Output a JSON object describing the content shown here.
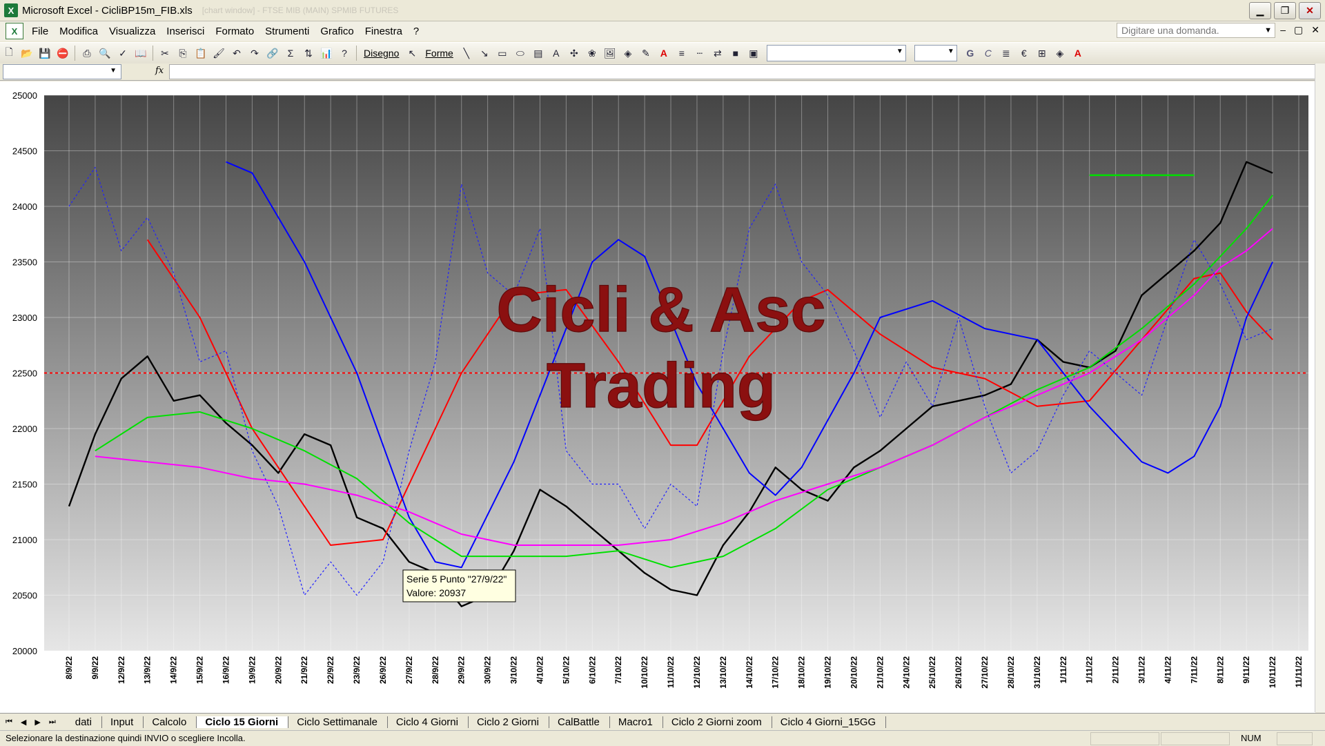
{
  "window": {
    "title": "Microsoft Excel - CicliBP15m_FIB.xls",
    "title_faint": "[chart window] - FTSE MIB (MAIN) SPMIB FUTURES",
    "buttons": {
      "minimize": "▁",
      "restore": "❐",
      "close": "✕"
    }
  },
  "menubar": {
    "items": [
      "File",
      "Modifica",
      "Visualizza",
      "Inserisci",
      "Formato",
      "Strumenti",
      "Grafico",
      "Finestra",
      "?"
    ],
    "ask_placeholder": "Digitare una domanda.",
    "controls": [
      "–",
      "▢",
      "✕"
    ]
  },
  "toolbar": {
    "draw_label": "Disegno",
    "shapes_label": "Forme",
    "bold": "G",
    "italic": "C",
    "euro": "€"
  },
  "formulabar": {
    "fx": "fx",
    "name_value": "",
    "formula_value": ""
  },
  "chart": {
    "watermark_line1": "Cicli & Asc",
    "watermark_line2": "Trading",
    "y_ticks": [
      "25000",
      "24500",
      "24000",
      "23500",
      "23000",
      "22500",
      "22000",
      "21500",
      "21000",
      "20500",
      "20000"
    ],
    "x_ticks": [
      "8/9/22",
      "9/9/22",
      "12/9/22",
      "13/9/22",
      "14/9/22",
      "15/9/22",
      "16/9/22",
      "19/9/22",
      "20/9/22",
      "21/9/22",
      "22/9/22",
      "23/9/22",
      "26/9/22",
      "27/9/22",
      "28/9/22",
      "29/9/22",
      "30/9/22",
      "3/10/22",
      "4/10/22",
      "5/10/22",
      "6/10/22",
      "7/10/22",
      "10/10/22",
      "11/10/22",
      "12/10/22",
      "13/10/22",
      "14/10/22",
      "17/10/22",
      "18/10/22",
      "19/10/22",
      "20/10/22",
      "21/10/22",
      "24/10/22",
      "25/10/22",
      "26/10/22",
      "27/10/22",
      "28/10/22",
      "31/10/22",
      "1/11/22",
      "1/11/22",
      "2/11/22",
      "3/11/22",
      "4/11/22",
      "7/11/22",
      "8/11/22",
      "9/11/22",
      "10/11/22",
      "11/11/22"
    ],
    "tooltip_line1": "Serie 5 Punto \"27/9/22\"",
    "tooltip_line2": "Valore: 20937",
    "colors": {
      "price": "#000000",
      "red": "#ff0000",
      "blue": "#0000ff",
      "green": "#00e000",
      "magenta": "#ff00ff",
      "dotted_blue": "#2020ff",
      "ref_line": "#ff0000"
    }
  },
  "chart_data": {
    "type": "line",
    "title": "",
    "xlabel": "",
    "ylabel": "",
    "ylim": [
      20000,
      25000
    ],
    "grid": true,
    "horizontal_reference": 22500,
    "series": [
      {
        "points": [
          [
            0,
            21300
          ],
          [
            1,
            21950
          ],
          [
            2,
            22450
          ],
          [
            3,
            22650
          ],
          [
            4,
            22250
          ],
          [
            5,
            22300
          ],
          [
            6,
            22050
          ],
          [
            7,
            21850
          ],
          [
            8,
            21600
          ],
          [
            9,
            21950
          ],
          [
            10,
            21850
          ],
          [
            11,
            21200
          ],
          [
            12,
            21100
          ],
          [
            13,
            20800
          ],
          [
            14,
            20700
          ],
          [
            15,
            20400
          ],
          [
            16,
            20500
          ],
          [
            17,
            20900
          ],
          [
            18,
            21450
          ],
          [
            19,
            21300
          ],
          [
            20,
            21100
          ],
          [
            21,
            20900
          ],
          [
            22,
            20700
          ],
          [
            23,
            20550
          ],
          [
            24,
            20500
          ],
          [
            25,
            20950
          ],
          [
            26,
            21250
          ],
          [
            27,
            21650
          ],
          [
            28,
            21450
          ],
          [
            29,
            21350
          ],
          [
            30,
            21650
          ],
          [
            31,
            21800
          ],
          [
            32,
            22000
          ],
          [
            33,
            22200
          ],
          [
            34,
            22250
          ],
          [
            35,
            22300
          ],
          [
            36,
            22400
          ],
          [
            37,
            22800
          ],
          [
            38,
            22600
          ],
          [
            39,
            22550
          ],
          [
            40,
            22700
          ],
          [
            41,
            23200
          ],
          [
            42,
            23400
          ],
          [
            43,
            23600
          ],
          [
            44,
            23850
          ],
          [
            45,
            24400
          ],
          [
            46,
            24300
          ]
        ]
      },
      {
        "points": [
          [
            3,
            23700
          ],
          [
            5,
            23000
          ],
          [
            7,
            22000
          ],
          [
            9,
            21300
          ],
          [
            10,
            20950
          ],
          [
            12,
            21000
          ],
          [
            14,
            22000
          ],
          [
            15,
            22500
          ],
          [
            17,
            23200
          ],
          [
            19,
            23250
          ],
          [
            21,
            22600
          ],
          [
            23,
            21850
          ],
          [
            24,
            21850
          ],
          [
            26,
            22650
          ],
          [
            28,
            23150
          ],
          [
            29,
            23250
          ],
          [
            31,
            22850
          ],
          [
            33,
            22550
          ],
          [
            35,
            22450
          ],
          [
            37,
            22200
          ],
          [
            39,
            22250
          ],
          [
            41,
            22800
          ],
          [
            43,
            23350
          ],
          [
            44,
            23400
          ],
          [
            45,
            23050
          ],
          [
            46,
            22800
          ]
        ]
      },
      {
        "points": [
          [
            6,
            24400
          ],
          [
            7,
            24300
          ],
          [
            9,
            23500
          ],
          [
            11,
            22500
          ],
          [
            13,
            21200
          ],
          [
            14,
            20800
          ],
          [
            15,
            20750
          ],
          [
            17,
            21700
          ],
          [
            19,
            22900
          ],
          [
            20,
            23500
          ],
          [
            21,
            23700
          ],
          [
            22,
            23550
          ],
          [
            24,
            22400
          ],
          [
            26,
            21600
          ],
          [
            27,
            21400
          ],
          [
            28,
            21650
          ],
          [
            30,
            22500
          ],
          [
            31,
            23000
          ],
          [
            33,
            23150
          ],
          [
            35,
            22900
          ],
          [
            37,
            22800
          ],
          [
            39,
            22200
          ],
          [
            41,
            21700
          ],
          [
            42,
            21600
          ],
          [
            43,
            21750
          ],
          [
            44,
            22200
          ],
          [
            45,
            23000
          ],
          [
            46,
            23500
          ]
        ]
      },
      {
        "points": [
          [
            1,
            21800
          ],
          [
            3,
            22100
          ],
          [
            5,
            22150
          ],
          [
            7,
            22000
          ],
          [
            9,
            21800
          ],
          [
            11,
            21550
          ],
          [
            13,
            21150
          ],
          [
            15,
            20850
          ],
          [
            17,
            20850
          ],
          [
            19,
            20850
          ],
          [
            21,
            20900
          ],
          [
            23,
            20750
          ],
          [
            25,
            20850
          ],
          [
            27,
            21100
          ],
          [
            29,
            21450
          ],
          [
            31,
            21650
          ],
          [
            33,
            21850
          ],
          [
            35,
            22100
          ],
          [
            37,
            22350
          ],
          [
            39,
            22550
          ],
          [
            41,
            22900
          ],
          [
            43,
            23300
          ],
          [
            44,
            23550
          ],
          [
            45,
            23800
          ],
          [
            46,
            24100
          ]
        ]
      },
      {
        "points": [
          [
            1,
            21750
          ],
          [
            3,
            21700
          ],
          [
            5,
            21650
          ],
          [
            7,
            21550
          ],
          [
            9,
            21500
          ],
          [
            11,
            21400
          ],
          [
            13,
            21250
          ],
          [
            15,
            21050
          ],
          [
            17,
            20950
          ],
          [
            19,
            20950
          ],
          [
            21,
            20950
          ],
          [
            23,
            21000
          ],
          [
            25,
            21150
          ],
          [
            27,
            21350
          ],
          [
            29,
            21500
          ],
          [
            31,
            21650
          ],
          [
            33,
            21850
          ],
          [
            35,
            22100
          ],
          [
            37,
            22300
          ],
          [
            39,
            22500
          ],
          [
            41,
            22800
          ],
          [
            43,
            23200
          ],
          [
            44,
            23450
          ],
          [
            45,
            23600
          ],
          [
            46,
            23800
          ]
        ]
      },
      {
        "points": [
          [
            0,
            24000
          ],
          [
            1,
            24350
          ],
          [
            2,
            23600
          ],
          [
            3,
            23900
          ],
          [
            4,
            23400
          ],
          [
            5,
            22600
          ],
          [
            6,
            22700
          ],
          [
            7,
            21800
          ],
          [
            8,
            21300
          ],
          [
            9,
            20500
          ],
          [
            10,
            20800
          ],
          [
            11,
            20500
          ],
          [
            12,
            20800
          ],
          [
            13,
            21800
          ],
          [
            14,
            22600
          ],
          [
            15,
            24200
          ],
          [
            16,
            23400
          ],
          [
            17,
            23200
          ],
          [
            18,
            23800
          ],
          [
            19,
            21800
          ],
          [
            20,
            21500
          ],
          [
            21,
            21500
          ],
          [
            22,
            21100
          ],
          [
            23,
            21500
          ],
          [
            24,
            21300
          ],
          [
            25,
            22700
          ],
          [
            26,
            23800
          ],
          [
            27,
            24200
          ],
          [
            28,
            23500
          ],
          [
            29,
            23200
          ],
          [
            30,
            22700
          ],
          [
            31,
            22100
          ],
          [
            32,
            22600
          ],
          [
            33,
            22200
          ],
          [
            34,
            23000
          ],
          [
            35,
            22200
          ],
          [
            36,
            21600
          ],
          [
            37,
            21800
          ],
          [
            38,
            22300
          ],
          [
            39,
            22700
          ],
          [
            40,
            22500
          ],
          [
            41,
            22300
          ],
          [
            42,
            23000
          ],
          [
            43,
            23700
          ],
          [
            44,
            23300
          ],
          [
            45,
            22800
          ],
          [
            46,
            22900
          ]
        ]
      }
    ],
    "line_segment": {
      "value": 24280,
      "x_from": 39,
      "x_to": 43
    }
  },
  "sheet_tabs": [
    "dati",
    "Input",
    "Calcolo",
    "Ciclo 15 Giorni",
    "Ciclo Settimanale",
    "Ciclo 4 Giorni",
    "Ciclo 2 Giorni",
    "CalBattle",
    "Macro1",
    "Ciclo 2 Giorni zoom",
    "Ciclo 4 Giorni_15GG"
  ],
  "active_tab": "Ciclo 15 Giorni",
  "tab_nav": [
    "⏮",
    "◀",
    "▶",
    "⏭"
  ],
  "status": {
    "message": "Selezionare la destinazione quindi INVIO o scegliere Incolla.",
    "num": "NUM"
  }
}
